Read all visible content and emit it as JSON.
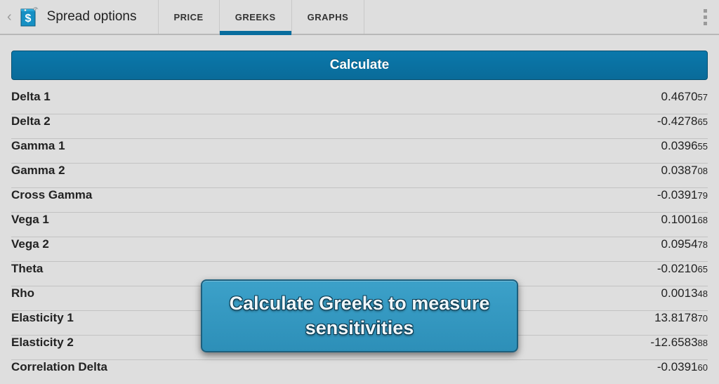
{
  "header": {
    "title": "Spread options",
    "tabs": [
      {
        "label": "PRICE",
        "active": false
      },
      {
        "label": "GREEKS",
        "active": true
      },
      {
        "label": "GRAPHS",
        "active": false
      }
    ]
  },
  "calculate_label": "Calculate",
  "greeks": [
    {
      "label": "Delta 1",
      "main": "0.4670",
      "sub": "57"
    },
    {
      "label": "Delta 2",
      "main": "-0.4278",
      "sub": "65"
    },
    {
      "label": "Gamma 1",
      "main": "0.0396",
      "sub": "55"
    },
    {
      "label": "Gamma 2",
      "main": "0.0387",
      "sub": "08"
    },
    {
      "label": "Cross Gamma",
      "main": "-0.0391",
      "sub": "79"
    },
    {
      "label": "Vega 1",
      "main": "0.1001",
      "sub": "68"
    },
    {
      "label": "Vega 2",
      "main": "0.0954",
      "sub": "78"
    },
    {
      "label": "Theta",
      "main": "-0.0210",
      "sub": "65"
    },
    {
      "label": "Rho",
      "main": "0.0013",
      "sub": "48"
    },
    {
      "label": "Elasticity 1",
      "main": "13.8178",
      "sub": "70"
    },
    {
      "label": "Elasticity 2",
      "main": "-12.6583",
      "sub": "88"
    },
    {
      "label": "Correlation Delta",
      "main": "-0.0391",
      "sub": "60"
    }
  ],
  "tooltip": "Calculate Greeks to measure sensitivities"
}
